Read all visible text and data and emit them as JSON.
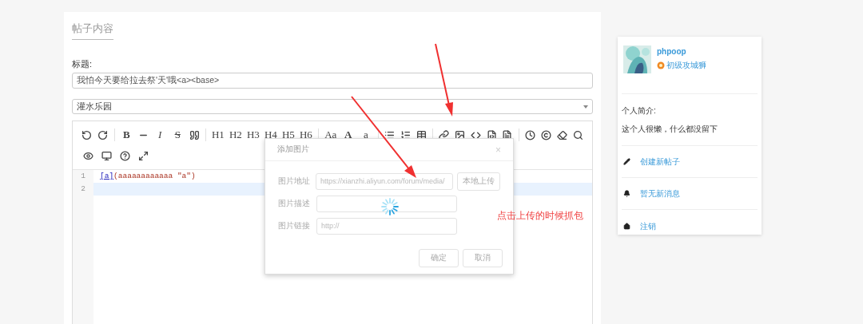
{
  "post_panel": {
    "heading": "帖子内容",
    "title_label": "标题:",
    "title_value": "我怕今天要给拉去祭'天'哦<a><base>",
    "category": "灌水乐园"
  },
  "toolbar": [
    {
      "kind": "icon"
    },
    {
      "kind": "icon"
    },
    {
      "kind": "sep"
    },
    {
      "kind": "bold",
      "label": "B"
    },
    {
      "kind": "icon"
    },
    {
      "kind": "italic",
      "label": "I"
    },
    {
      "kind": "strike",
      "label": "S"
    },
    {
      "kind": "icon"
    },
    {
      "kind": "sep"
    },
    {
      "kind": "text",
      "label": "H1"
    },
    {
      "kind": "text",
      "label": "H2"
    },
    {
      "kind": "text",
      "label": "H3"
    },
    {
      "kind": "text",
      "label": "H4"
    },
    {
      "kind": "text",
      "label": "H5"
    },
    {
      "kind": "text",
      "label": "H6"
    },
    {
      "kind": "sep"
    },
    {
      "kind": "text",
      "label": "Aa"
    },
    {
      "kind": "bold",
      "label": "A"
    },
    {
      "kind": "text",
      "label": "a"
    },
    {
      "kind": "sep"
    },
    {
      "kind": "icon"
    },
    {
      "kind": "icon"
    },
    {
      "kind": "icon"
    },
    {
      "kind": "sep"
    },
    {
      "kind": "icon"
    },
    {
      "kind": "icon"
    },
    {
      "kind": "icon"
    },
    {
      "kind": "icon"
    },
    {
      "kind": "icon"
    },
    {
      "kind": "sep"
    },
    {
      "kind": "icon"
    },
    {
      "kind": "icon"
    },
    {
      "kind": "icon"
    },
    {
      "kind": "icon"
    },
    {
      "kind": "break"
    },
    {
      "kind": "icon"
    },
    {
      "kind": "icon"
    },
    {
      "kind": "icon"
    },
    {
      "kind": "icon"
    }
  ],
  "editor_lines": [
    {
      "number": "1",
      "link": "[a]",
      "rest": "(aaaaaaaaaaaa \"a\")",
      "active": false
    },
    {
      "number": "2",
      "active": true
    }
  ],
  "dialog": {
    "title": "添加图片",
    "close": "×",
    "fields": [
      {
        "label": "图片地址",
        "value": "https://xianzhi.aliyun.com/forum/media/",
        "button": "本地上传"
      },
      {
        "label": "图片描述"
      },
      {
        "label": "图片链接",
        "placeholder": "http://"
      }
    ],
    "buttons": [
      "确定",
      "取消"
    ]
  },
  "annotation": "点击上传的时候抓包",
  "profile": {
    "username": "phpoop",
    "rank": "初级攻城狮",
    "bio_label": "个人简介:",
    "bio": "这个人很懒，什么都没留下",
    "links": [
      {
        "kind": "pencil",
        "label": "创建新帖子"
      },
      {
        "kind": "bell",
        "label": "暂无新消息"
      },
      {
        "kind": "home",
        "label": "注销"
      }
    ]
  }
}
